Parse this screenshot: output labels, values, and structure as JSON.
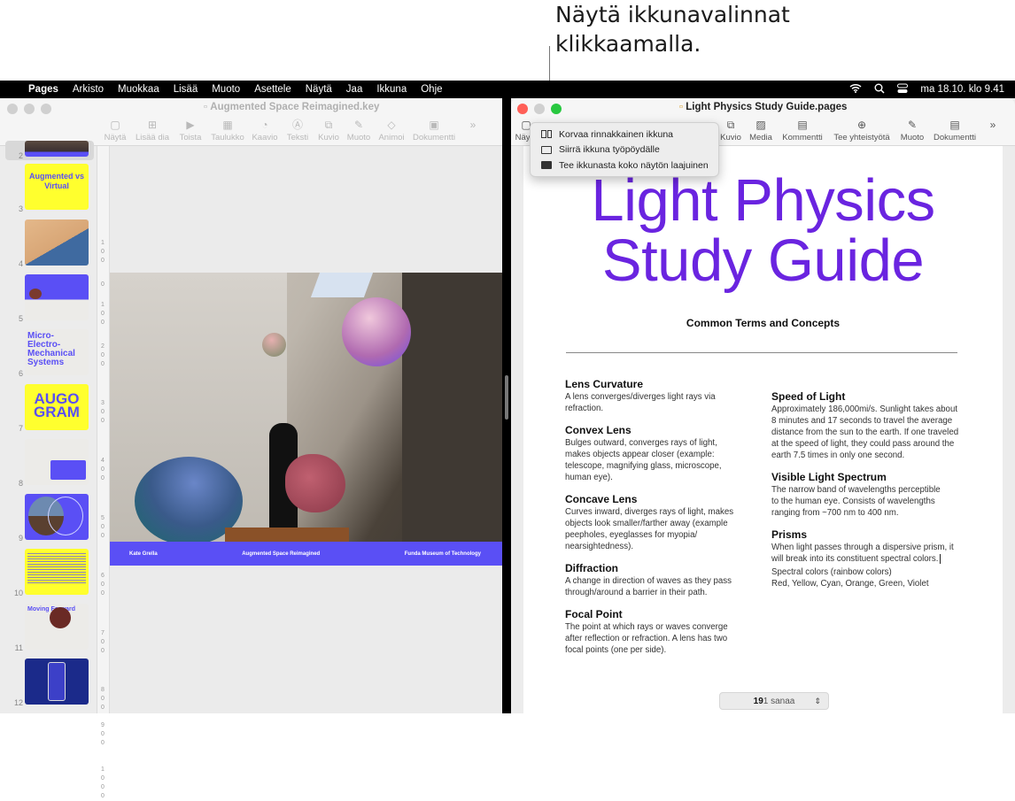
{
  "callout": {
    "line1": "Näytä ikkunavalinnat",
    "line2": "klikkaamalla."
  },
  "menubar": {
    "app": "Pages",
    "items": [
      "Arkisto",
      "Muokkaa",
      "Lisää",
      "Muoto",
      "Asettele",
      "Näytä",
      "Jaa",
      "Ikkuna",
      "Ohje"
    ],
    "clock": "ma 18.10. klo 9.41"
  },
  "left_window": {
    "title": "Augmented Space Reimagined.key",
    "toolbar": [
      "Näytä",
      "Lisää dia",
      "Toista",
      "Taulukko",
      "Kaavio",
      "Teksti",
      "Kuvio",
      "Muoto",
      "Animoi",
      "Dokumentti"
    ],
    "slides": [
      {
        "num": "2"
      },
      {
        "num": "3",
        "text": "Augmented vs Virtual"
      },
      {
        "num": "4"
      },
      {
        "num": "5"
      },
      {
        "num": "6",
        "text": "Micro-Electro-Mechanical Systems"
      },
      {
        "num": "7",
        "text": "AUGO GRAM"
      },
      {
        "num": "8"
      },
      {
        "num": "9"
      },
      {
        "num": "10"
      },
      {
        "num": "11",
        "text": "Moving Forward"
      },
      {
        "num": "12"
      }
    ],
    "ruler_labels": [
      "100",
      "0",
      "100",
      "200",
      "300",
      "400",
      "500",
      "600",
      "700",
      "800",
      "900",
      "1000"
    ],
    "slide_footer": {
      "left": "Kate Grella",
      "center": "Augmented Space Reimagined",
      "right": "Funda Museum of Technology"
    }
  },
  "right_window": {
    "title": "Light Physics Study Guide.pages",
    "toolbar": [
      "Näytä",
      "Kuvio",
      "Media",
      "Kommentti",
      "Tee yhteistyötä",
      "Muoto",
      "Dokumentti"
    ],
    "window_menu": [
      "Korvaa rinnakkainen ikkuna",
      "Siirrä ikkuna työpöydälle",
      "Tee ikkunasta koko näytön laajuinen"
    ],
    "document": {
      "title_line1": "Light Physics",
      "title_line2": "Study Guide",
      "subtitle": "Common Terms and Concepts",
      "left_terms": [
        {
          "heading": "Lens Curvature",
          "body": "A lens converges/diverges light rays via refraction."
        },
        {
          "heading": "Convex Lens",
          "body": "Bulges outward, converges rays of light, makes objects appear closer (example: telescope, magnifying glass, microscope, human eye)."
        },
        {
          "heading": "Concave Lens",
          "body": "Curves inward, diverges rays of light, makes objects look smaller/farther away (example peepholes, eyeglasses for myopia/ nearsightedness)."
        },
        {
          "heading": "Diffraction",
          "body": "A change in direction of waves as they pass through/around a barrier in their path."
        },
        {
          "heading": "Focal Point",
          "body": "The point at which rays or waves converge after reflection or refraction. A lens has two focal points (one per side)."
        }
      ],
      "right_terms": [
        {
          "heading": "Speed of Light",
          "body": "Approximately 186,000mi/s. Sunlight takes about 8 minutes and 17 seconds to travel the average distance from the sun to the earth. If one traveled at the speed of light, they could pass around the earth 7.5 times in only one second."
        },
        {
          "heading": "Visible Light Spectrum",
          "body": "The narrow band of wavelengths perceptible to the human eye. Consists of wavelengths ranging from ~700 nm to 400 nm."
        },
        {
          "heading": "Prisms",
          "body": "When light passes through a dispersive prism, it will break into its constituent spectral colors."
        }
      ],
      "extra_line1": "Spectral colors (rainbow colors)",
      "extra_line2": "Red, Yellow, Cyan, Orange, Green, Violet"
    },
    "word_count": {
      "bold": "19",
      "rest": "1 sanaa"
    }
  },
  "colors": {
    "title_purple": "#6a24e0",
    "slide_blue": "#5a4ff5",
    "close_red": "#ff5f57",
    "zoom_green": "#28c840"
  }
}
